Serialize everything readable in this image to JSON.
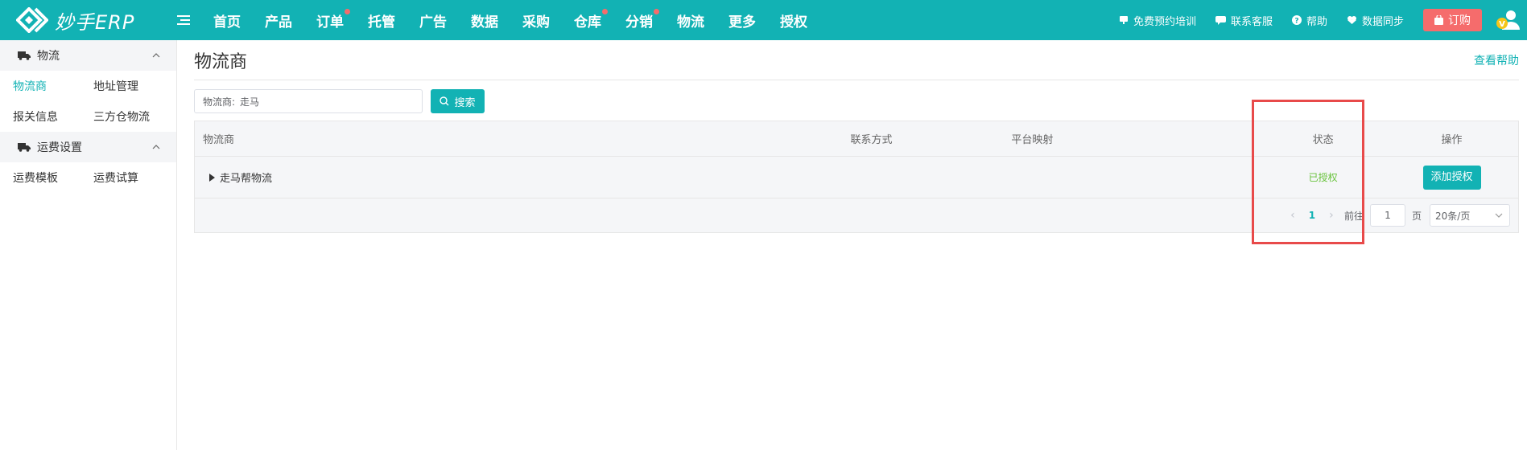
{
  "app": {
    "logo_text": "妙手ERP",
    "nav": [
      {
        "label": "首页",
        "dot": false
      },
      {
        "label": "产品",
        "dot": false
      },
      {
        "label": "订单",
        "dot": true
      },
      {
        "label": "托管",
        "dot": false
      },
      {
        "label": "广告",
        "dot": false
      },
      {
        "label": "数据",
        "dot": false
      },
      {
        "label": "采购",
        "dot": false
      },
      {
        "label": "仓库",
        "dot": true
      },
      {
        "label": "分销",
        "dot": true
      },
      {
        "label": "物流",
        "dot": false
      },
      {
        "label": "更多",
        "dot": false
      },
      {
        "label": "授权",
        "dot": false
      }
    ],
    "topright": {
      "training": "免费预约培训",
      "support": "联系客服",
      "help": "帮助",
      "sync": "数据同步",
      "subscribe": "订购"
    },
    "avatar_badge": "V"
  },
  "sidebar": {
    "groups": [
      {
        "label": "物流",
        "icon": "truck-icon",
        "rows": [
          [
            "物流商",
            "地址管理"
          ],
          [
            "报关信息",
            "三方仓物流"
          ]
        ]
      },
      {
        "label": "运费设置",
        "icon": "truck-icon",
        "rows": [
          [
            "运费模板",
            "运费试算"
          ]
        ]
      }
    ],
    "active": "物流商"
  },
  "main": {
    "title": "物流商",
    "help_link": "查看帮助",
    "search": {
      "label": "物流商:",
      "value": "走马",
      "button": "搜索"
    },
    "table": {
      "headers": {
        "provider": "物流商",
        "contact": "联系方式",
        "mapping": "平台映射",
        "status": "状态",
        "op": "操作"
      },
      "rows": [
        {
          "provider": "走马帮物流",
          "contact": "",
          "mapping": "",
          "status": "已授权",
          "op": "添加授权"
        }
      ]
    },
    "pagination": {
      "current_page": "1",
      "goto_label": "前往",
      "goto_value": "1",
      "page_suffix": "页",
      "page_size": "20条/页"
    }
  },
  "colors": {
    "brand": "#12b2b4",
    "alert": "#f56c6c",
    "success": "#67c23a",
    "highlight": "#e84a4a"
  }
}
